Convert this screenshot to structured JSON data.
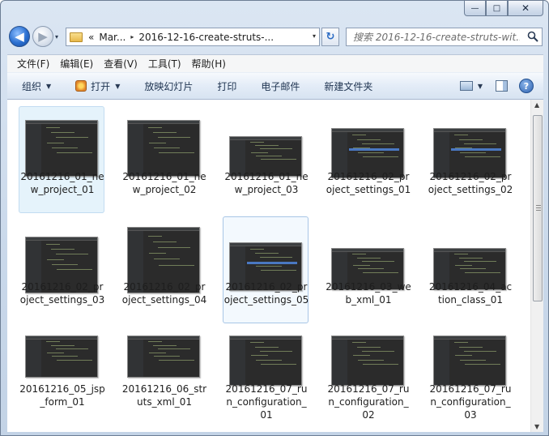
{
  "window": {
    "caption_buttons": {
      "minimize": "—",
      "maximize": "□",
      "close": "✕"
    }
  },
  "nav": {
    "back_glyph": "◀",
    "forward_glyph": "▶",
    "history_glyph": "▾",
    "address": {
      "overflow": "«",
      "segments": [
        "Mar...",
        "2016-12-16-create-struts-..."
      ],
      "separator": "▸",
      "dropdown": "▾"
    },
    "refresh_glyph": "↻",
    "search_placeholder": "搜索 2016-12-16-create-struts-wit...",
    "search_icon": "magnifier-icon"
  },
  "menubar": {
    "items": [
      "文件(F)",
      "编辑(E)",
      "查看(V)",
      "工具(T)",
      "帮助(H)"
    ]
  },
  "commandbar": {
    "organize": "组织",
    "open": "打开",
    "slideshow": "放映幻灯片",
    "print": "打印",
    "email": "电子邮件",
    "new_folder": "新建文件夹",
    "dropdown_glyph": "▼",
    "help_glyph": "?"
  },
  "files": [
    {
      "name": "20161216_01_new_project_01",
      "state": "selected"
    },
    {
      "name": "20161216_01_new_project_02",
      "state": ""
    },
    {
      "name": "20161216_01_new_project_03",
      "state": ""
    },
    {
      "name": "20161216_02_project_settings_01",
      "state": ""
    },
    {
      "name": "20161216_02_project_settings_02",
      "state": ""
    },
    {
      "name": "20161216_02_project_settings_03",
      "state": ""
    },
    {
      "name": "20161216_02_project_settings_04",
      "state": ""
    },
    {
      "name": "20161216_02_project_settings_05",
      "state": "focused"
    },
    {
      "name": "20161216_03_web_xml_01",
      "state": ""
    },
    {
      "name": "20161216_04_action_class_01",
      "state": ""
    },
    {
      "name": "20161216_05_jsp_form_01",
      "state": ""
    },
    {
      "name": "20161216_06_struts_xml_01",
      "state": ""
    },
    {
      "name": "20161216_07_run_configuration_01",
      "state": ""
    },
    {
      "name": "20161216_07_run_configuration_02",
      "state": ""
    },
    {
      "name": "20161216_07_run_configuration_03",
      "state": ""
    }
  ],
  "scrollbar": {
    "up": "▲",
    "down": "▼",
    "position": 0.0
  }
}
